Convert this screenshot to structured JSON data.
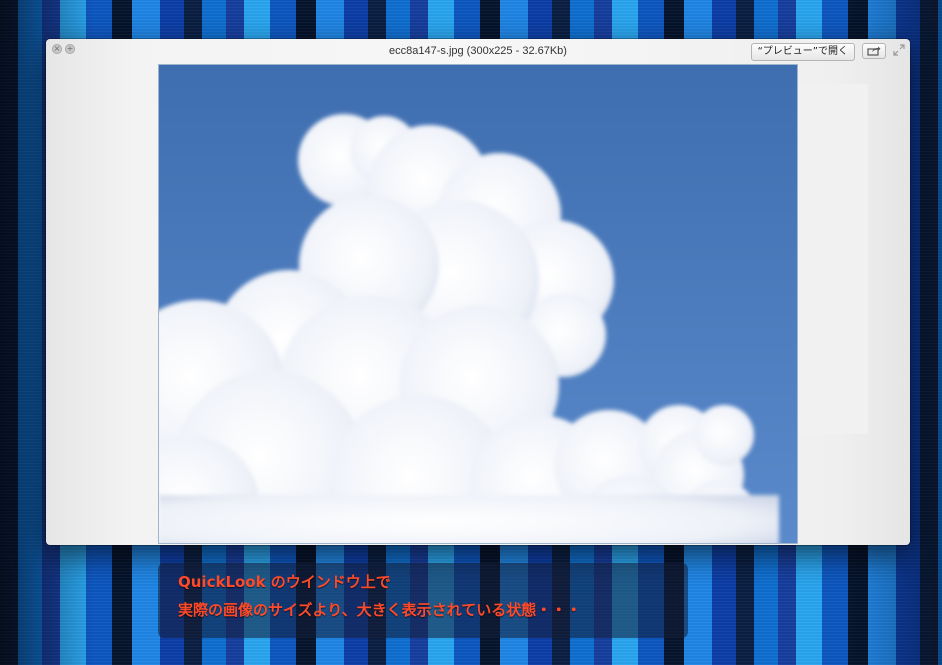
{
  "window": {
    "title": "ecc8a147-s.jpg (300x225 - 32.67Kb)",
    "open_button_label": "“プレビュー”で開く",
    "close_glyph": "×",
    "fullscreen_glyph": "+"
  },
  "icons": {
    "close": "close-icon",
    "fullscreen": "fullscreen-icon",
    "share": "share-icon",
    "expand": "expand-icon"
  },
  "image": {
    "subject": "cloud-image",
    "sky_color": "#4a7bbd",
    "cloud_color": "#f4f6fb"
  },
  "caption": {
    "line1": "QuickLook のウインドウ上で",
    "line2": "実際の画像のサイズより、大きく表示されている状態・・・",
    "text_color": "#ff4a2a"
  }
}
